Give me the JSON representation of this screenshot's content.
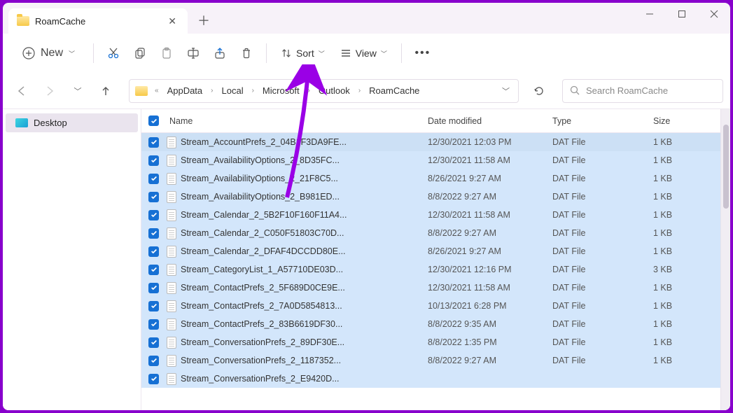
{
  "tab": {
    "title": "RoamCache"
  },
  "toolbar": {
    "new_label": "New",
    "sort_label": "Sort",
    "view_label": "View"
  },
  "breadcrumbs": [
    "AppData",
    "Local",
    "Microsoft",
    "Outlook",
    "RoamCache"
  ],
  "search": {
    "placeholder": "Search RoamCache"
  },
  "sidebar": {
    "desktop": "Desktop"
  },
  "columns": {
    "name": "Name",
    "date": "Date modified",
    "type": "Type",
    "size": "Size"
  },
  "files": [
    {
      "name": "Stream_AccountPrefs_2_04B1F3DA9FE...",
      "date": "12/30/2021 12:03 PM",
      "type": "DAT File",
      "size": "1 KB"
    },
    {
      "name": "Stream_AvailabilityOptions_2_8D35FC...",
      "date": "12/30/2021 11:58 AM",
      "type": "DAT File",
      "size": "1 KB"
    },
    {
      "name": "Stream_AvailabilityOptions_2_21F8C5...",
      "date": "8/26/2021 9:27 AM",
      "type": "DAT File",
      "size": "1 KB"
    },
    {
      "name": "Stream_AvailabilityOptions_2_B981ED...",
      "date": "8/8/2022 9:27 AM",
      "type": "DAT File",
      "size": "1 KB"
    },
    {
      "name": "Stream_Calendar_2_5B2F10F160F11A4...",
      "date": "12/30/2021 11:58 AM",
      "type": "DAT File",
      "size": "1 KB"
    },
    {
      "name": "Stream_Calendar_2_C050F51803C70D...",
      "date": "8/8/2022 9:27 AM",
      "type": "DAT File",
      "size": "1 KB"
    },
    {
      "name": "Stream_Calendar_2_DFAF4DCCDD80E...",
      "date": "8/26/2021 9:27 AM",
      "type": "DAT File",
      "size": "1 KB"
    },
    {
      "name": "Stream_CategoryList_1_A57710DE03D...",
      "date": "12/30/2021 12:16 PM",
      "type": "DAT File",
      "size": "3 KB"
    },
    {
      "name": "Stream_ContactPrefs_2_5F689D0CE9E...",
      "date": "12/30/2021 11:58 AM",
      "type": "DAT File",
      "size": "1 KB"
    },
    {
      "name": "Stream_ContactPrefs_2_7A0D5854813...",
      "date": "10/13/2021 6:28 PM",
      "type": "DAT File",
      "size": "1 KB"
    },
    {
      "name": "Stream_ContactPrefs_2_83B6619DF30...",
      "date": "8/8/2022 9:35 AM",
      "type": "DAT File",
      "size": "1 KB"
    },
    {
      "name": "Stream_ConversationPrefs_2_89DF30E...",
      "date": "8/8/2022 1:35 PM",
      "type": "DAT File",
      "size": "1 KB"
    },
    {
      "name": "Stream_ConversationPrefs_2_1187352...",
      "date": "8/8/2022 9:27 AM",
      "type": "DAT File",
      "size": "1 KB"
    },
    {
      "name": "Stream_ConversationPrefs_2_E9420D...",
      "date": "",
      "type": "",
      "size": ""
    }
  ]
}
